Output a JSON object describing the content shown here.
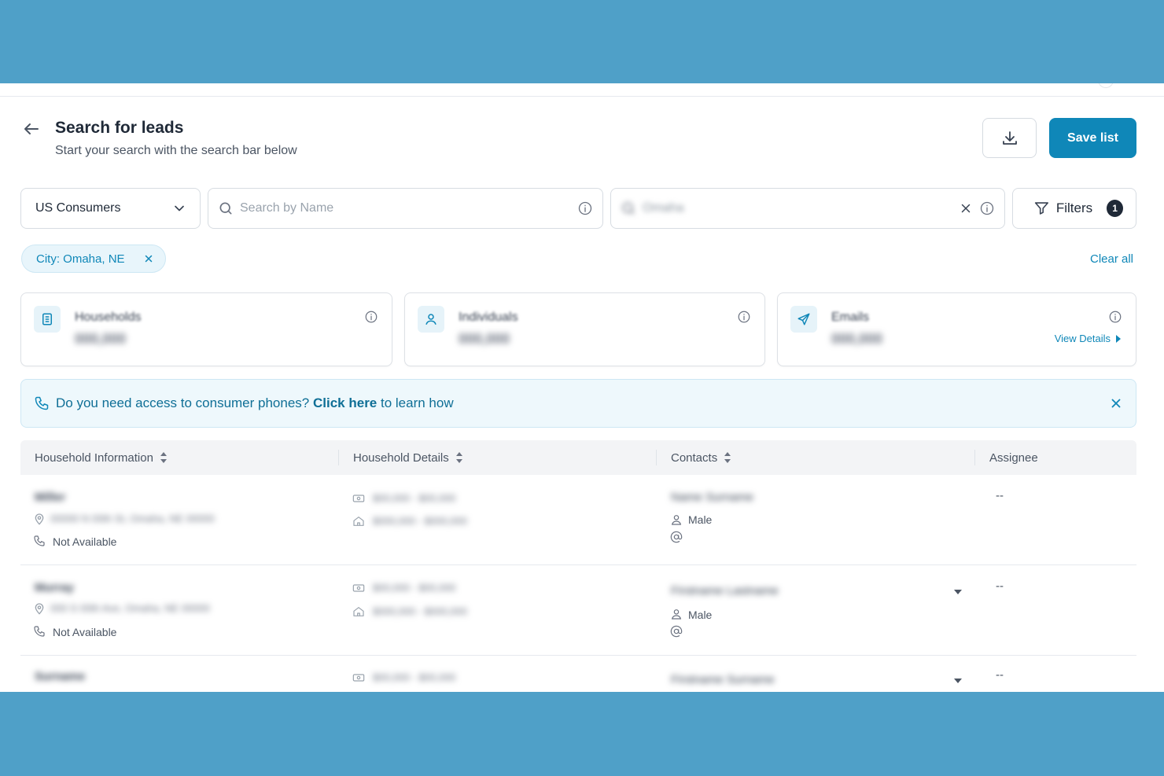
{
  "header": {
    "title": "Search for leads",
    "subtitle": "Start your search with the search bar below",
    "save_label": "Save list"
  },
  "search": {
    "database_selected": "US Consumers",
    "name_placeholder": "Search by Name",
    "location_value": "Omaha",
    "filters_label": "Filters",
    "filters_count": "1"
  },
  "applied_filters": {
    "chips": [
      {
        "label": "City: Omaha, NE"
      }
    ],
    "clear_all_label": "Clear all"
  },
  "stats": {
    "households": {
      "label": "Households",
      "value": "000,000"
    },
    "individuals": {
      "label": "Individuals",
      "value": "000,000"
    },
    "emails": {
      "label": "Emails",
      "value": "000,000",
      "view_details_label": "View Details"
    }
  },
  "banner": {
    "prefix": "Do you need access to consumer phones?",
    "link": "Click here",
    "suffix": "to learn how"
  },
  "table": {
    "columns": [
      "Household Information",
      "Household Details",
      "Contacts",
      "Assignee"
    ],
    "rows": [
      {
        "name": "Miller",
        "address": "00000 N 00th St, Omaha, NE 00000",
        "phone": "Not Available",
        "income": "$00,000 - $00,000",
        "home_value": "$000,000 - $000,000",
        "contact_name": "Name Surname",
        "gender": "Male",
        "assignee": "--"
      },
      {
        "name": "Murray",
        "address": "000 S 00th Ave, Omaha, NE 00000",
        "phone": "Not Available",
        "income": "$00,000 - $00,000",
        "home_value": "$000,000 - $000,000",
        "contact_name": "Firstname Lastname",
        "gender": "Male",
        "assignee": "--"
      },
      {
        "name": "Surname",
        "address": "",
        "phone": "",
        "income": "$00,000 - $00,000",
        "home_value": "",
        "contact_name": "Firstname Surname",
        "gender": "",
        "assignee": "--"
      }
    ]
  },
  "colors": {
    "accent": "#0f87b8",
    "outer_background": "#4fa0c8",
    "banner_background": "#eef8fc"
  },
  "icons": [
    "arrow-left-icon",
    "download-icon",
    "chevron-down-icon",
    "search-icon",
    "info-icon",
    "close-icon",
    "filter-icon",
    "building-icon",
    "user-icon",
    "send-icon",
    "play-right-icon",
    "phone-icon",
    "map-pin-icon",
    "money-icon",
    "home-icon",
    "person-icon",
    "at-sign-icon",
    "sort-icon",
    "caret-down-icon"
  ]
}
